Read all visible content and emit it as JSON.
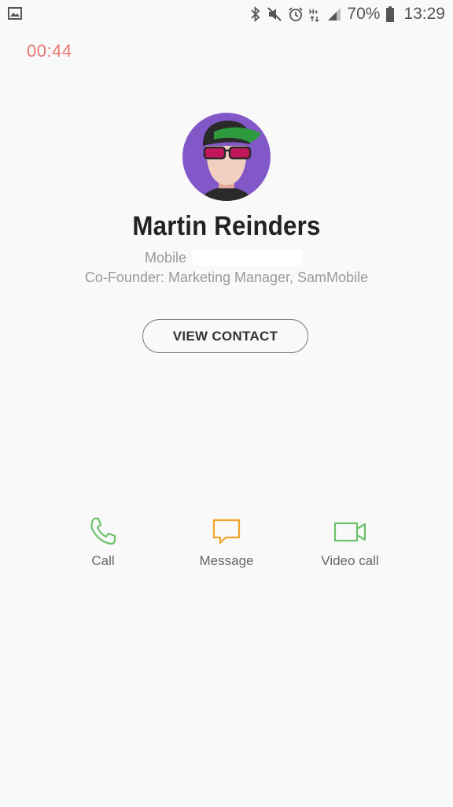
{
  "status_bar": {
    "left_icon": "image-notification-icon",
    "icons": [
      "bluetooth-icon",
      "mute-icon",
      "alarm-icon",
      "hplus-data-icon",
      "signal-icon"
    ],
    "battery_percent": "70%",
    "time": "13:29"
  },
  "call": {
    "timer": "00:44"
  },
  "contact": {
    "name": "Martin Reinders",
    "number_type": "Mobile",
    "title": "Co-Founder: Marketing Manager, SamMobile",
    "avatar_bg": "#8258c8"
  },
  "buttons": {
    "view_contact": "VIEW CONTACT"
  },
  "actions": [
    {
      "label": "Call",
      "icon": "phone-icon",
      "color": "#6dc26a"
    },
    {
      "label": "Message",
      "icon": "message-icon",
      "color": "#f0a42a"
    },
    {
      "label": "Video call",
      "icon": "video-camera-icon",
      "color": "#6dc26a"
    }
  ]
}
